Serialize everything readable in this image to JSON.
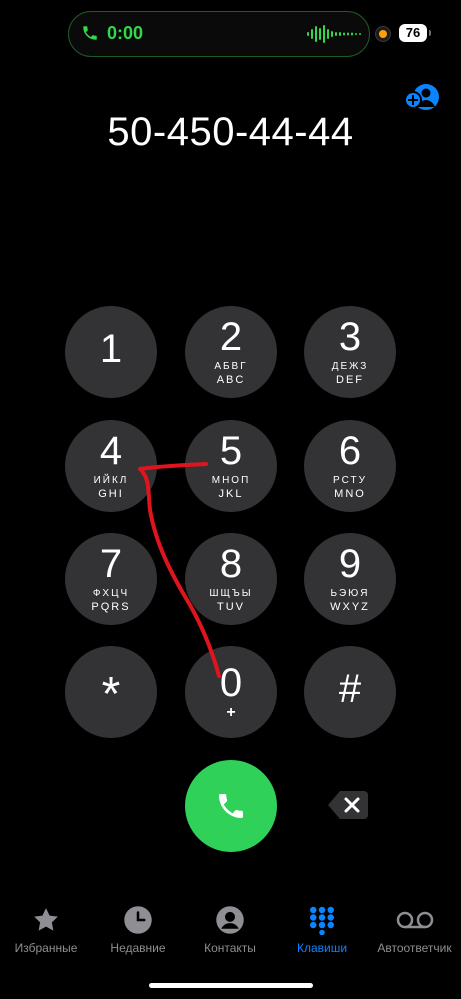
{
  "status_bar": {
    "call_timer": "0:00",
    "battery_level": "76"
  },
  "dialer": {
    "number": "50-450-44-44"
  },
  "keypad": [
    {
      "digit": "1",
      "cyr": "",
      "lat": ""
    },
    {
      "digit": "2",
      "cyr": "АБВГ",
      "lat": "ABC"
    },
    {
      "digit": "3",
      "cyr": "ДЕЖЗ",
      "lat": "DEF"
    },
    {
      "digit": "4",
      "cyr": "ИЙКЛ",
      "lat": "GHI"
    },
    {
      "digit": "5",
      "cyr": "МНОП",
      "lat": "JKL"
    },
    {
      "digit": "6",
      "cyr": "РСТУ",
      "lat": "MNO"
    },
    {
      "digit": "7",
      "cyr": "ФХЦЧ",
      "lat": "PQRS"
    },
    {
      "digit": "8",
      "cyr": "ШЩЪЫ",
      "lat": "TUV"
    },
    {
      "digit": "9",
      "cyr": "ЬЭЮЯ",
      "lat": "WXYZ"
    },
    {
      "digit": "*",
      "cyr": "",
      "lat": ""
    },
    {
      "digit": "0",
      "cyr": "",
      "lat": "",
      "sub": "+"
    },
    {
      "digit": "#",
      "cyr": "",
      "lat": ""
    }
  ],
  "tabs": [
    {
      "label": "Избранные",
      "icon": "star-icon",
      "active": false
    },
    {
      "label": "Недавние",
      "icon": "clock-icon",
      "active": false
    },
    {
      "label": "Контакты",
      "icon": "person-circle-icon",
      "active": false
    },
    {
      "label": "Клавиши",
      "icon": "keypad-grid-icon",
      "active": true
    },
    {
      "label": "Автоответчик",
      "icon": "voicemail-icon",
      "active": false
    }
  ],
  "colors": {
    "accent": "#0a84ff",
    "call_green": "#30d158",
    "key_bg": "#333335",
    "annotation_red": "#e0141e"
  }
}
